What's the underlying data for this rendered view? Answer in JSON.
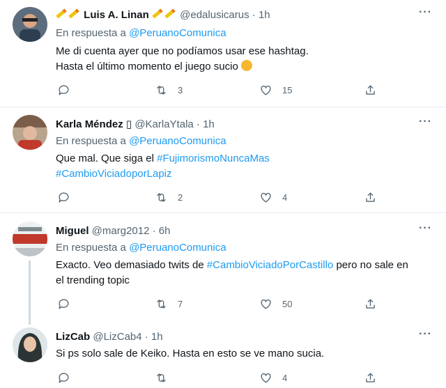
{
  "colors": {
    "link": "#1d9bf0",
    "muted": "#536471",
    "text": "#0f1419",
    "divider": "#e6ecf0"
  },
  "tweets": [
    {
      "name": "Luis A. Linan",
      "name_decoration": "pencil emojis",
      "handle": "@edalusicarus",
      "separator": "·",
      "time": "1h",
      "reply_prefix": "En respuesta a",
      "reply_to": "@PeruanoComunica",
      "line1": "Me di cuenta ayer que no podíamos usar ese hashtag.",
      "line2": "Hasta el último momento el juego sucio",
      "emoji": "face-with-symbols-icon",
      "retweets": "3",
      "likes": "15"
    },
    {
      "name": "Karla Méndez",
      "name_suffix": "▯",
      "handle": "@KarlaYtala",
      "separator": "·",
      "time": "1h",
      "reply_prefix": "En respuesta a",
      "reply_to": "@PeruanoComunica",
      "text_prefix": "Que mal. Que siga el",
      "hashtag1": "#FujimorismoNuncaMas",
      "hashtag2": "#CambioViciadoporLapiz",
      "retweets": "2",
      "likes": "4"
    },
    {
      "name": "Miguel",
      "handle": "@marg2012",
      "separator": "·",
      "time": "6h",
      "reply_prefix": "En respuesta a",
      "reply_to": "@PeruanoComunica",
      "text_prefix": "Exacto. Veo demasiado twits de",
      "hashtag": "#CambioViciadoPorCastillo",
      "text_suffix": "pero no sale en",
      "line2": "el trending topic",
      "retweets": "7",
      "likes": "50"
    },
    {
      "name": "LizCab",
      "handle": "@LizCab4",
      "separator": "·",
      "time": "1h",
      "text": "Si ps solo sale de Keiko. Hasta en esto se ve mano sucia.",
      "retweets": "",
      "likes": "4"
    }
  ]
}
